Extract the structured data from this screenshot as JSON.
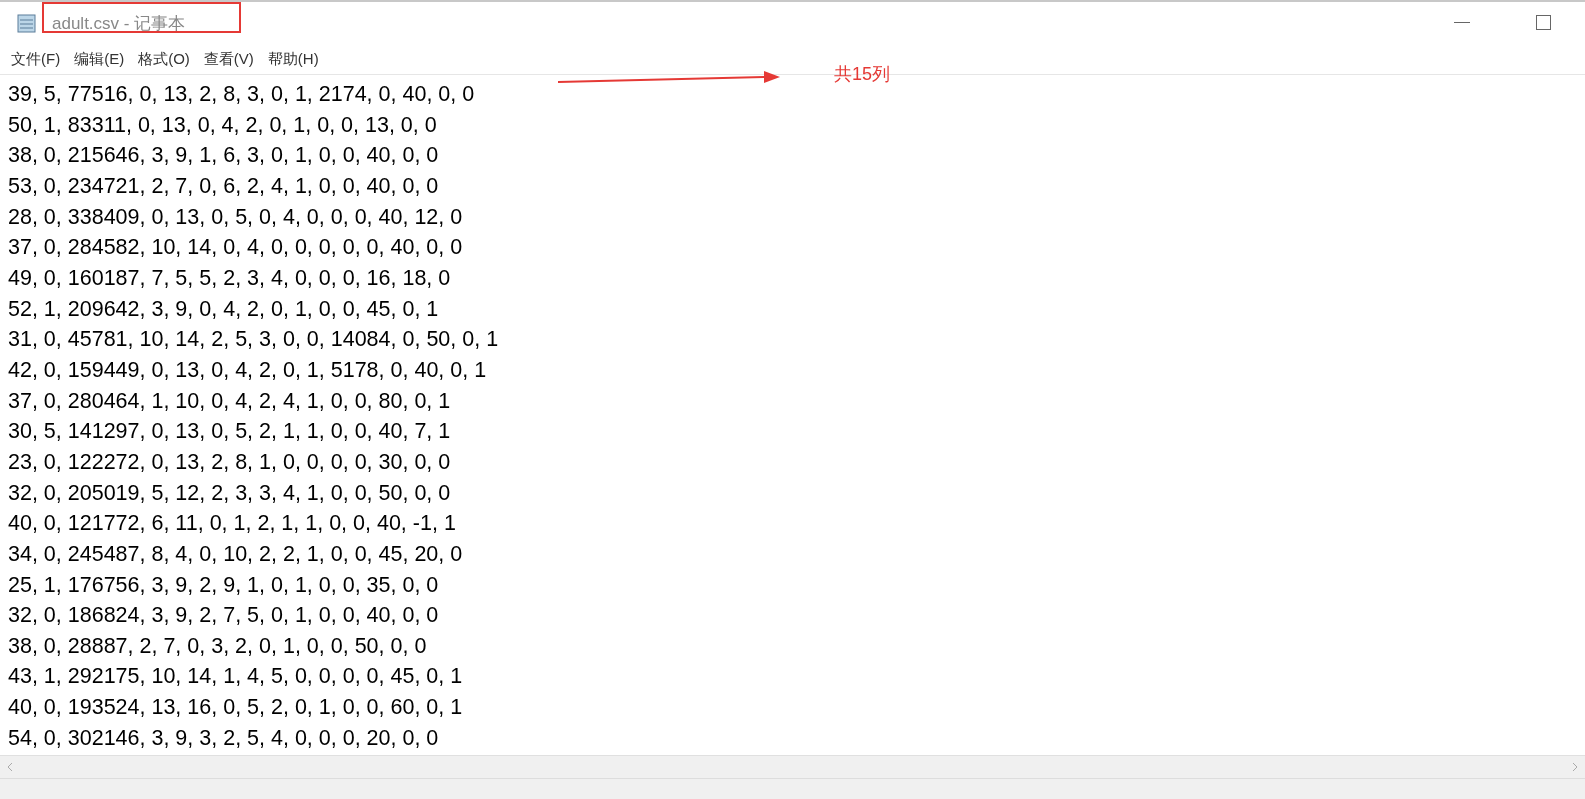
{
  "window": {
    "title": "adult.csv - 记事本"
  },
  "menu": [
    "文件(F)",
    "编辑(E)",
    "格式(O)",
    "查看(V)",
    "帮助(H)"
  ],
  "lines": [
    "39, 5, 77516, 0, 13, 2, 8, 3, 0, 1, 2174, 0, 40, 0, 0",
    "50, 1, 83311, 0, 13, 0, 4, 2, 0, 1, 0, 0, 13, 0, 0",
    "38, 0, 215646, 3, 9, 1, 6, 3, 0, 1, 0, 0, 40, 0, 0",
    "53, 0, 234721, 2, 7, 0, 6, 2, 4, 1, 0, 0, 40, 0, 0",
    "28, 0, 338409, 0, 13, 0, 5, 0, 4, 0, 0, 0, 40, 12, 0",
    "37, 0, 284582, 10, 14, 0, 4, 0, 0, 0, 0, 0, 40, 0, 0",
    "49, 0, 160187, 7, 5, 5, 2, 3, 4, 0, 0, 0, 16, 18, 0",
    "52, 1, 209642, 3, 9, 0, 4, 2, 0, 1, 0, 0, 45, 0, 1",
    "31, 0, 45781, 10, 14, 2, 5, 3, 0, 0, 14084, 0, 50, 0, 1",
    "42, 0, 159449, 0, 13, 0, 4, 2, 0, 1, 5178, 0, 40, 0, 1",
    "37, 0, 280464, 1, 10, 0, 4, 2, 4, 1, 0, 0, 80, 0, 1",
    "30, 5, 141297, 0, 13, 0, 5, 2, 1, 1, 0, 0, 40, 7, 1",
    "23, 0, 122272, 0, 13, 2, 8, 1, 0, 0, 0, 0, 30, 0, 0",
    "32, 0, 205019, 5, 12, 2, 3, 3, 4, 1, 0, 0, 50, 0, 0",
    "40, 0, 121772, 6, 11, 0, 1, 2, 1, 1, 0, 0, 40, -1, 1",
    "34, 0, 245487, 8, 4, 0, 10, 2, 2, 1, 0, 0, 45, 20, 0",
    "25, 1, 176756, 3, 9, 2, 9, 1, 0, 1, 0, 0, 35, 0, 0",
    "32, 0, 186824, 3, 9, 2, 7, 5, 0, 1, 0, 0, 40, 0, 0",
    "38, 0, 28887, 2, 7, 0, 3, 2, 0, 1, 0, 0, 50, 0, 0",
    "43, 1, 292175, 10, 14, 1, 4, 5, 0, 0, 0, 0, 45, 0, 1",
    "40, 0, 193524, 13, 16, 0, 5, 2, 0, 1, 0, 0, 60, 0, 1",
    "54, 0, 302146, 3, 9, 3, 2, 5, 4, 0, 0, 0, 20, 0, 0"
  ],
  "annotation": {
    "label": "共15列"
  }
}
